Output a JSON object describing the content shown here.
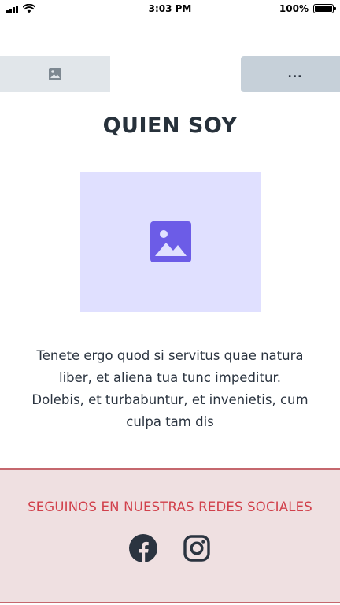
{
  "status_bar": {
    "time": "3:03 PM",
    "battery_percent": "100%",
    "signal_icon": "signal-icon",
    "wifi_icon": "wifi-icon",
    "battery_icon": "battery-icon"
  },
  "header": {
    "logo_icon": "image-placeholder-icon",
    "menu_label": "..."
  },
  "main": {
    "title": "QUIEN SOY",
    "hero_icon": "image-placeholder-icon",
    "bio": "Tenete ergo quod si servitus quae natura liber, et aliena tua tunc impeditur. Dolebis, et turbabuntur, et invenietis, cum culpa tam dis"
  },
  "footer": {
    "heading": "SEGUINOS EN NUESTRAS REDES SOCIALES",
    "social": [
      {
        "icon": "facebook-icon"
      },
      {
        "icon": "instagram-icon"
      }
    ]
  },
  "colors": {
    "title": "#27313b",
    "accent_red": "#d1404b",
    "footer_bg": "#efe0e1",
    "footer_border": "#c5676d",
    "image_bg": "#e0e0ff",
    "image_icon": "#6c5ce7",
    "menu_bg": "#c6d0d9",
    "logo_bg": "#e1e6ea"
  }
}
